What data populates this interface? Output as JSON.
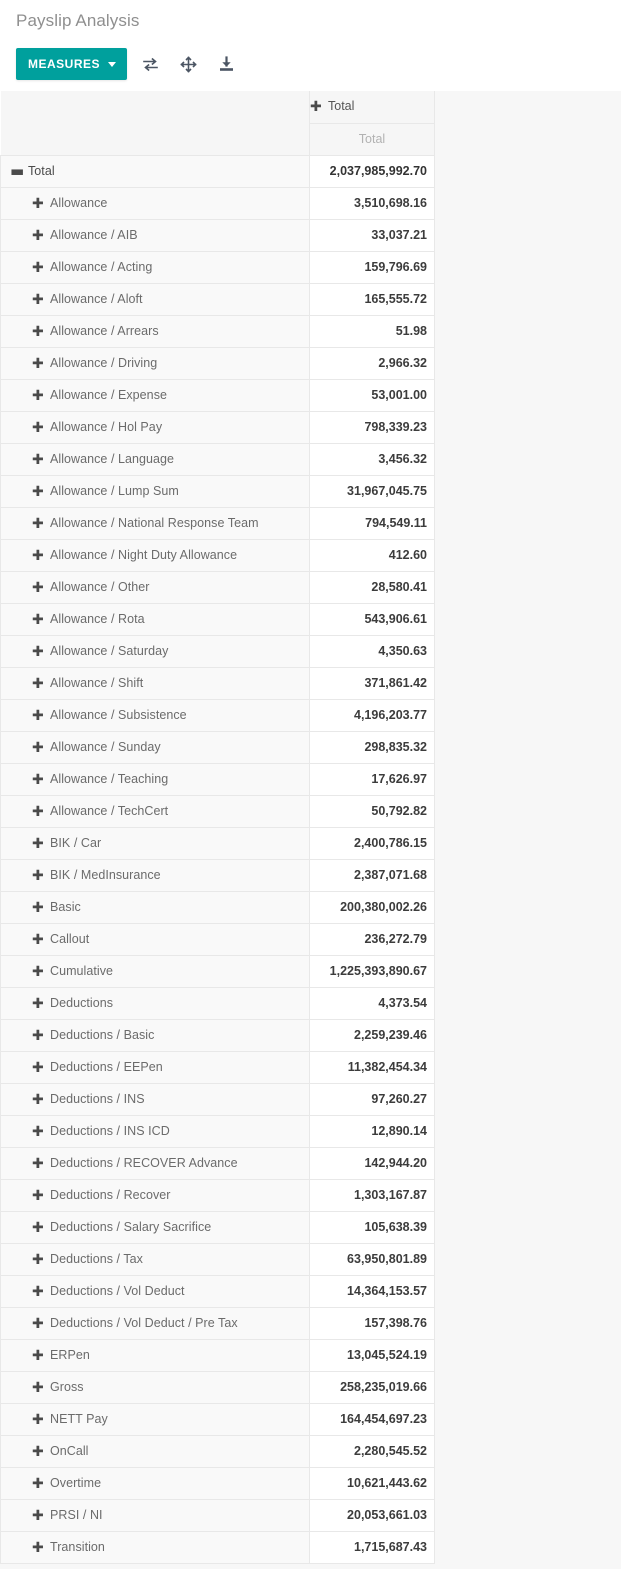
{
  "header": {
    "title": "Payslip Analysis",
    "measures_label": "MEASURES",
    "icons": [
      {
        "name": "flip-axis-icon",
        "title": "Flip axis"
      },
      {
        "name": "expand-all-icon",
        "title": "Expand all"
      },
      {
        "name": "download-xlsx-icon",
        "title": "Download xlsx"
      }
    ]
  },
  "colors": {
    "accent_teal": "#00a09d",
    "title_gray": "#8f8f8f",
    "row_label_bg": "#f9f9f9",
    "header_bg": "#f6f6f6",
    "border": "#e8e8e8",
    "canvas_bg": "#f7f7f7"
  },
  "table": {
    "column_header_top": "Total",
    "column_header_sub": "Total",
    "root_row": {
      "label": "Total",
      "value": "2,037,985,992.70",
      "expanded": true
    },
    "rows": [
      {
        "label": "Allowance",
        "value": "3,510,698.16"
      },
      {
        "label": "Allowance / AIB",
        "value": "33,037.21"
      },
      {
        "label": "Allowance / Acting",
        "value": "159,796.69"
      },
      {
        "label": "Allowance / Aloft",
        "value": "165,555.72"
      },
      {
        "label": "Allowance / Arrears",
        "value": "51.98"
      },
      {
        "label": "Allowance / Driving",
        "value": "2,966.32"
      },
      {
        "label": "Allowance / Expense",
        "value": "53,001.00"
      },
      {
        "label": "Allowance / Hol Pay",
        "value": "798,339.23"
      },
      {
        "label": "Allowance / Language",
        "value": "3,456.32"
      },
      {
        "label": "Allowance / Lump Sum",
        "value": "31,967,045.75"
      },
      {
        "label": "Allowance / National Response Team",
        "value": "794,549.11"
      },
      {
        "label": "Allowance / Night Duty Allowance",
        "value": "412.60"
      },
      {
        "label": "Allowance / Other",
        "value": "28,580.41"
      },
      {
        "label": "Allowance / Rota",
        "value": "543,906.61"
      },
      {
        "label": "Allowance / Saturday",
        "value": "4,350.63"
      },
      {
        "label": "Allowance / Shift",
        "value": "371,861.42"
      },
      {
        "label": "Allowance / Subsistence",
        "value": "4,196,203.77"
      },
      {
        "label": "Allowance / Sunday",
        "value": "298,835.32"
      },
      {
        "label": "Allowance / Teaching",
        "value": "17,626.97"
      },
      {
        "label": "Allowance / TechCert",
        "value": "50,792.82"
      },
      {
        "label": "BIK / Car",
        "value": "2,400,786.15"
      },
      {
        "label": "BIK / MedInsurance",
        "value": "2,387,071.68"
      },
      {
        "label": "Basic",
        "value": "200,380,002.26"
      },
      {
        "label": "Callout",
        "value": "236,272.79"
      },
      {
        "label": "Cumulative",
        "value": "1,225,393,890.67"
      },
      {
        "label": "Deductions",
        "value": "4,373.54"
      },
      {
        "label": "Deductions / Basic",
        "value": "2,259,239.46"
      },
      {
        "label": "Deductions / EEPen",
        "value": "11,382,454.34"
      },
      {
        "label": "Deductions / INS",
        "value": "97,260.27"
      },
      {
        "label": "Deductions / INS ICD",
        "value": "12,890.14"
      },
      {
        "label": "Deductions / RECOVER Advance",
        "value": "142,944.20"
      },
      {
        "label": "Deductions / Recover",
        "value": "1,303,167.87"
      },
      {
        "label": "Deductions / Salary Sacrifice",
        "value": "105,638.39"
      },
      {
        "label": "Deductions / Tax",
        "value": "63,950,801.89"
      },
      {
        "label": "Deductions / Vol Deduct",
        "value": "14,364,153.57"
      },
      {
        "label": "Deductions / Vol Deduct / Pre Tax",
        "value": "157,398.76"
      },
      {
        "label": "ERPen",
        "value": "13,045,524.19"
      },
      {
        "label": "Gross",
        "value": "258,235,019.66"
      },
      {
        "label": "NETT Pay",
        "value": "164,454,697.23"
      },
      {
        "label": "OnCall",
        "value": "2,280,545.52"
      },
      {
        "label": "Overtime",
        "value": "10,621,443.62"
      },
      {
        "label": "PRSI / NI",
        "value": "20,053,661.03"
      },
      {
        "label": "Transition",
        "value": "1,715,687.43"
      }
    ]
  },
  "glyphs": {
    "plus": "✚",
    "minus": "▬"
  }
}
